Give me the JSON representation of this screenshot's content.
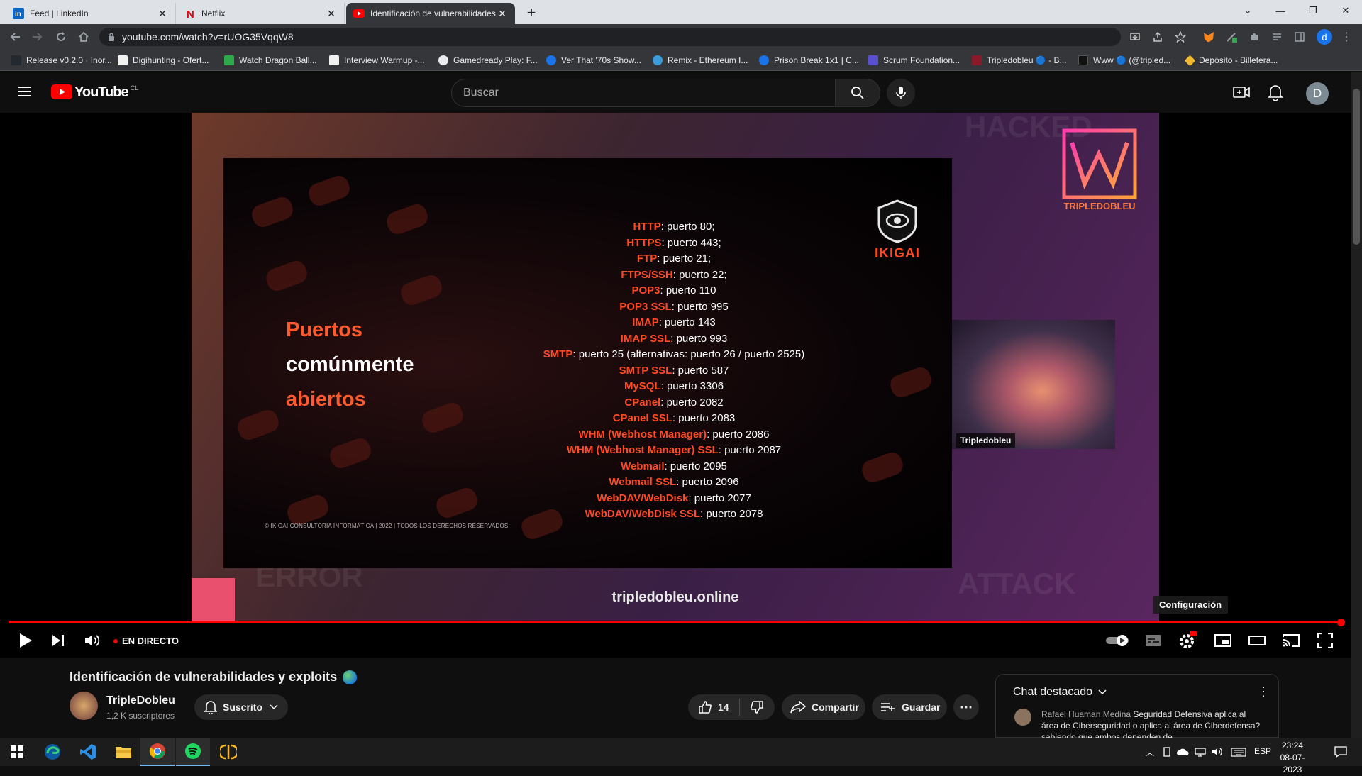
{
  "browser": {
    "tabs": [
      {
        "title": "Feed | LinkedIn"
      },
      {
        "title": "Netflix"
      },
      {
        "title": "Identificación de vulnerabilidades y exploits"
      }
    ],
    "url": "youtube.com/watch?v=rUOG35VqqW8",
    "bookmarks": [
      "Release v0.2.0 · Inor...",
      "Digihunting - Ofert...",
      "Watch Dragon Ball...",
      "Interview Warmup -...",
      "Gamedready Play: F...",
      "Ver That '70s Show...",
      "Remix - Ethereum I...",
      "Prison Break 1x1 | C...",
      "Scrum Foundation...",
      "Tripledobleu 🔵 - B...",
      "Www 🔵 (@tripled...",
      "Depósito - Billetera..."
    ],
    "profile_initial": "d"
  },
  "youtube": {
    "logo_text": "YouTube",
    "region": "CL",
    "search_placeholder": "Buscar",
    "avatar_initial": "D"
  },
  "video": {
    "slide_title": [
      "Puertos",
      "comúnmente",
      "abiertos"
    ],
    "ports": [
      {
        "proto": "HTTP",
        "value": "puerto 80;"
      },
      {
        "proto": "HTTPS",
        "value": "puerto 443;"
      },
      {
        "proto": "FTP",
        "value": "puerto 21;"
      },
      {
        "proto": "FTPS/SSH",
        "value": "puerto 22;"
      },
      {
        "proto": "POP3",
        "value": "puerto 110"
      },
      {
        "proto": "POP3 SSL",
        "value": "puerto 995"
      },
      {
        "proto": "IMAP",
        "value": "puerto 143"
      },
      {
        "proto": "IMAP SSL",
        "value": "puerto 993"
      },
      {
        "proto": "SMTP",
        "value": "puerto 25 (alternativas: puerto 26 / puerto 2525)"
      },
      {
        "proto": "SMTP SSL",
        "value": "puerto 587"
      },
      {
        "proto": "MySQL",
        "value": "puerto 3306"
      },
      {
        "proto": "CPanel",
        "value": "puerto 2082"
      },
      {
        "proto": "CPanel SSL",
        "value": "puerto 2083"
      },
      {
        "proto": "WHM (Webhost Manager)",
        "value": "puerto 2086"
      },
      {
        "proto": "WHM (Webhost Manager) SSL",
        "value": "puerto 2087"
      },
      {
        "proto": "Webmail",
        "value": "puerto 2095"
      },
      {
        "proto": "Webmail SSL",
        "value": "puerto 2096"
      },
      {
        "proto": "WebDAV/WebDisk",
        "value": "puerto 2077"
      },
      {
        "proto": "WebDAV/WebDisk SSL",
        "value": "puerto 2078"
      }
    ],
    "copyright": "© IKIGAI CONSULTORIA INFORMÁTICA | 2022 | TODOS LOS DERECHOS RESERVADOS.",
    "ikigai_logo": "IKIGAI",
    "brand_logo": "TRIPLEDOBLEU",
    "webcam_name": "Tripledobleu",
    "site_url": "tripledobleu.online",
    "tooltip": "Configuración",
    "live_label": "EN DIRECTO"
  },
  "meta": {
    "title": "Identificación de vulnerabilidades y exploits",
    "channel": "TripleDobleu",
    "subscribers": "1,2 K suscriptores",
    "subscribe_label": "Suscrito",
    "likes": "14",
    "share_label": "Compartir",
    "save_label": "Guardar"
  },
  "chat": {
    "header": "Chat destacado",
    "author": "Rafael Huaman Medina",
    "message": "Seguridad Defensiva aplica al área de Ciberseguridad o aplica al área de Ciberdefensa? sabiendo que ambos dependen de"
  },
  "taskbar": {
    "lang": "ESP",
    "time": "23:24",
    "date": "08-07-2023"
  },
  "colors": {
    "accent_red": "#ff0000",
    "slide_orange": "#ff4a24"
  }
}
